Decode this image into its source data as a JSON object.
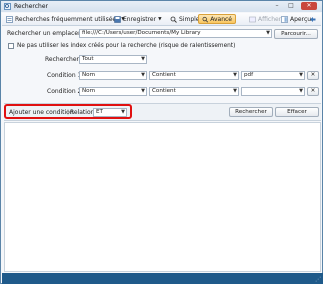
{
  "window": {
    "title": "Rechercher",
    "minimize_glyph": "–",
    "maximize_glyph": "□",
    "close_glyph": "✕"
  },
  "toolbar": {
    "frequent_searches": "Recherches fréquemment utilisées",
    "save": "Enregistrer",
    "simple": "Simple",
    "advanced": "Avancé",
    "display": "Afficher",
    "preview": "Aperçu"
  },
  "search": {
    "location_label": "Rechercher un emplacement :",
    "location_value": "file:///C:/Users/user/Documents/My Library",
    "browse_button": "Parcourir...",
    "no_index_label": "Ne pas utiliser les index créés pour la recherche (risque de ralentissement)",
    "search_label": "Rechercher :",
    "search_value": "Tout"
  },
  "conditions": [
    {
      "label": "Condition 1 :",
      "field": "Nom",
      "operator": "Contient",
      "value": "pdf"
    },
    {
      "label": "Condition 2 :",
      "field": "Nom",
      "operator": "Contient",
      "value": ""
    }
  ],
  "actions": {
    "add_condition": "Ajouter une condition",
    "relation_label": "Relation :",
    "relation_value": "ET",
    "search_button": "Rechercher",
    "clear_button": "Effacer"
  },
  "colors": {
    "highlight_border": "#e01010",
    "statusbar": "#1f5a8a",
    "active_tab": "#f9c65e"
  }
}
